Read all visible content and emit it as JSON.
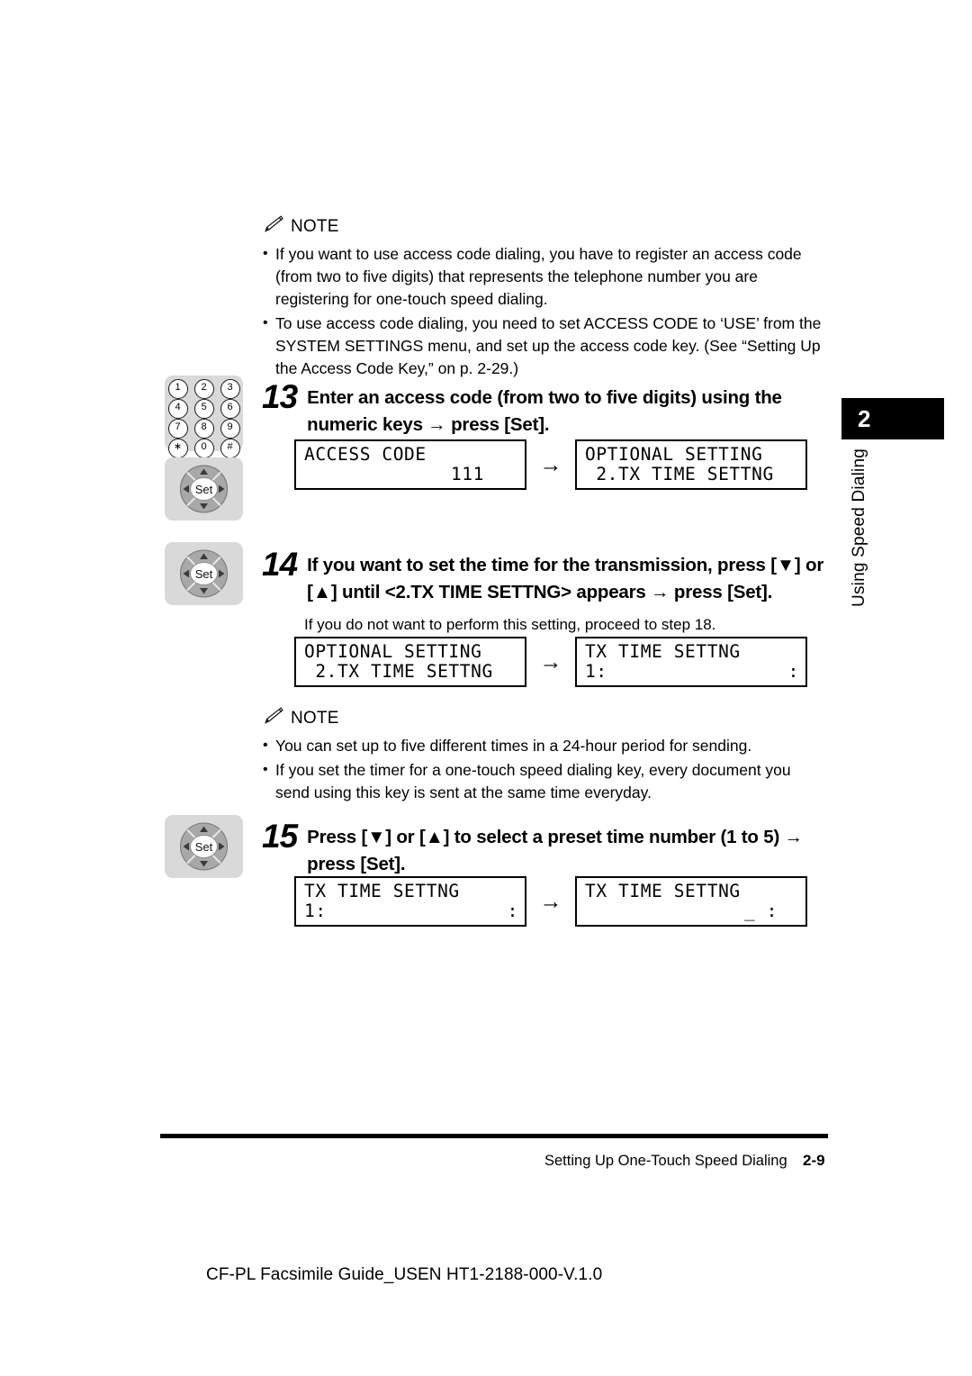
{
  "chapter_tab": {
    "number": "2",
    "label": "Using Speed Dialing"
  },
  "notes": [
    {
      "title": "NOTE",
      "icon": "pencil-icon",
      "items": [
        "If you want to use access code dialing, you have to register an access code (from two to five digits) that represents the telephone number you are registering for one-touch speed dialing.",
        "To use access code dialing, you need to set ACCESS CODE to ‘USE’ from the SYSTEM SETTINGS menu, and set up the access code key. (See “Setting Up the Access Code Key,” on p. 2-29.)"
      ]
    },
    {
      "title": "NOTE",
      "icon": "pencil-icon",
      "items": [
        "You can set up to five different times in a 24-hour period for sending.",
        "If you set the timer for a one-touch speed dialing key, every document you send using this key is sent at the same time everyday."
      ]
    }
  ],
  "steps": [
    {
      "number": "13",
      "text": "Enter an access code (from two to five digits) using the numeric keys → press [Set].",
      "subtext": "",
      "icons": [
        "numeric-keypad-icon",
        "set-navigation-icon"
      ],
      "lcds": [
        {
          "line1": "ACCESS CODE",
          "line2": "111",
          "line2_align": "right"
        },
        {
          "line1": "OPTIONAL SETTING",
          "line2": " 2.TX TIME SETTNG",
          "line2_align": "left"
        }
      ],
      "arrow": "→"
    },
    {
      "number": "14",
      "text": "If you want to set the time for the transmission, press [▼] or [▲] until <2.TX TIME SETTNG> appears → press [Set].",
      "subtext": "If you do not want to perform this setting, proceed to step 18.",
      "icons": [
        "set-navigation-icon"
      ],
      "lcds": [
        {
          "line1": "OPTIONAL SETTING",
          "line2": " 2.TX TIME SETTNG",
          "line2_align": "left"
        },
        {
          "line1": "TX TIME SETTNG",
          "line2_left": "1:",
          "line2_right": ":",
          "line2_align": "split"
        }
      ],
      "arrow": "→"
    },
    {
      "number": "15",
      "text": "Press [▼] or [▲] to select a preset time number (1 to 5) → press [Set].",
      "subtext": "",
      "icons": [
        "set-navigation-icon"
      ],
      "lcds": [
        {
          "line1": "TX TIME SETTNG",
          "line2_left": "1:",
          "line2_right": ":",
          "line2_align": "split"
        },
        {
          "line1": "TX TIME SETTNG",
          "line2": "_ :",
          "line2_align": "rightish"
        }
      ],
      "arrow": "→"
    }
  ],
  "keypad": {
    "keys": [
      "1",
      "2",
      "3",
      "4",
      "5",
      "6",
      "7",
      "8",
      "9",
      "∗",
      "0",
      "#"
    ]
  },
  "setpad": {
    "center_label": "Set"
  },
  "footer": {
    "section": "Setting Up One-Touch Speed Dialing",
    "page": "2-9"
  },
  "caption": "CF-PL Facsimile Guide_USEN HT1-2188-000-V.1.0"
}
